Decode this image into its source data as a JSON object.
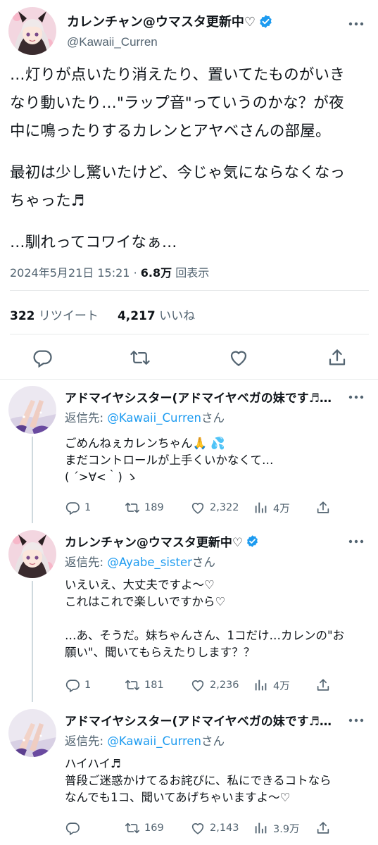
{
  "main": {
    "display_name": "カレンチャン@ウマスタ更新中♡",
    "handle": "@Kawaii_Curren",
    "text": [
      "…灯りが点いたり消えたり、置いてたものがいき\nなり動いたり…\"ラップ音\"っていうのかな？が夜\n中に鳴ったりするカレンとアヤベさんの部屋。",
      "最初は少し驚いたけど、今じゃ気にならなくなっ\nちゃった♬",
      "…馴れってコワイなぁ…"
    ],
    "timestamp": "2024年5月21日 15:21",
    "views": "6.8万",
    "views_label": "回表示",
    "retweets": "322",
    "retweets_label": "リツイート",
    "likes": "4,217",
    "likes_label": "いいね",
    "icons": [
      "reply-icon",
      "retweet-icon",
      "like-icon",
      "share-icon"
    ]
  },
  "replies": [
    {
      "display_name": "アドマイヤシスター(アドマイヤベガの妹です♬…",
      "verified": false,
      "reply_to_prefix": "返信先: ",
      "reply_to_handle": "@Kawaii_Curren",
      "reply_to_suffix": "さん",
      "text": [
        "ごめんねぇカレンちゃん🙏 💦\nまだコントロールが上手くいかなくて…\n( ´>∀<｀) ゝ"
      ],
      "replies": "1",
      "retweets": "189",
      "likes": "2,322",
      "views": "4万"
    },
    {
      "display_name": "カレンチャン@ウマスタ更新中♡",
      "verified": true,
      "reply_to_prefix": "返信先: ",
      "reply_to_handle": "@Ayabe_sister",
      "reply_to_suffix": "さん",
      "text": [
        "いえいえ、大丈夫ですよ～♡\nこれはこれで楽しいですから♡",
        "…あ、そうだ。妹ちゃんさん、1コだけ…カレンの\"お\n願い\"、聞いてもらえたりします？？"
      ],
      "replies": "1",
      "retweets": "181",
      "likes": "2,236",
      "views": "4万"
    },
    {
      "display_name": "アドマイヤシスター(アドマイヤベガの妹です♬…",
      "verified": false,
      "reply_to_prefix": "返信先: ",
      "reply_to_handle": "@Kawaii_Curren",
      "reply_to_suffix": "さん",
      "text": [
        "ハイハイ♬\n普段ご迷惑かけてるお詫びに、私にできるコトなら\nなんでも1コ、聞いてあげちゃいますよ～♡"
      ],
      "replies": "",
      "retweets": "169",
      "likes": "2,143",
      "views": "3.9万"
    }
  ],
  "colors": {
    "text": "#0f1419",
    "secondary": "#536471",
    "link": "#1d9bf0",
    "divider": "#e7e9ea"
  }
}
